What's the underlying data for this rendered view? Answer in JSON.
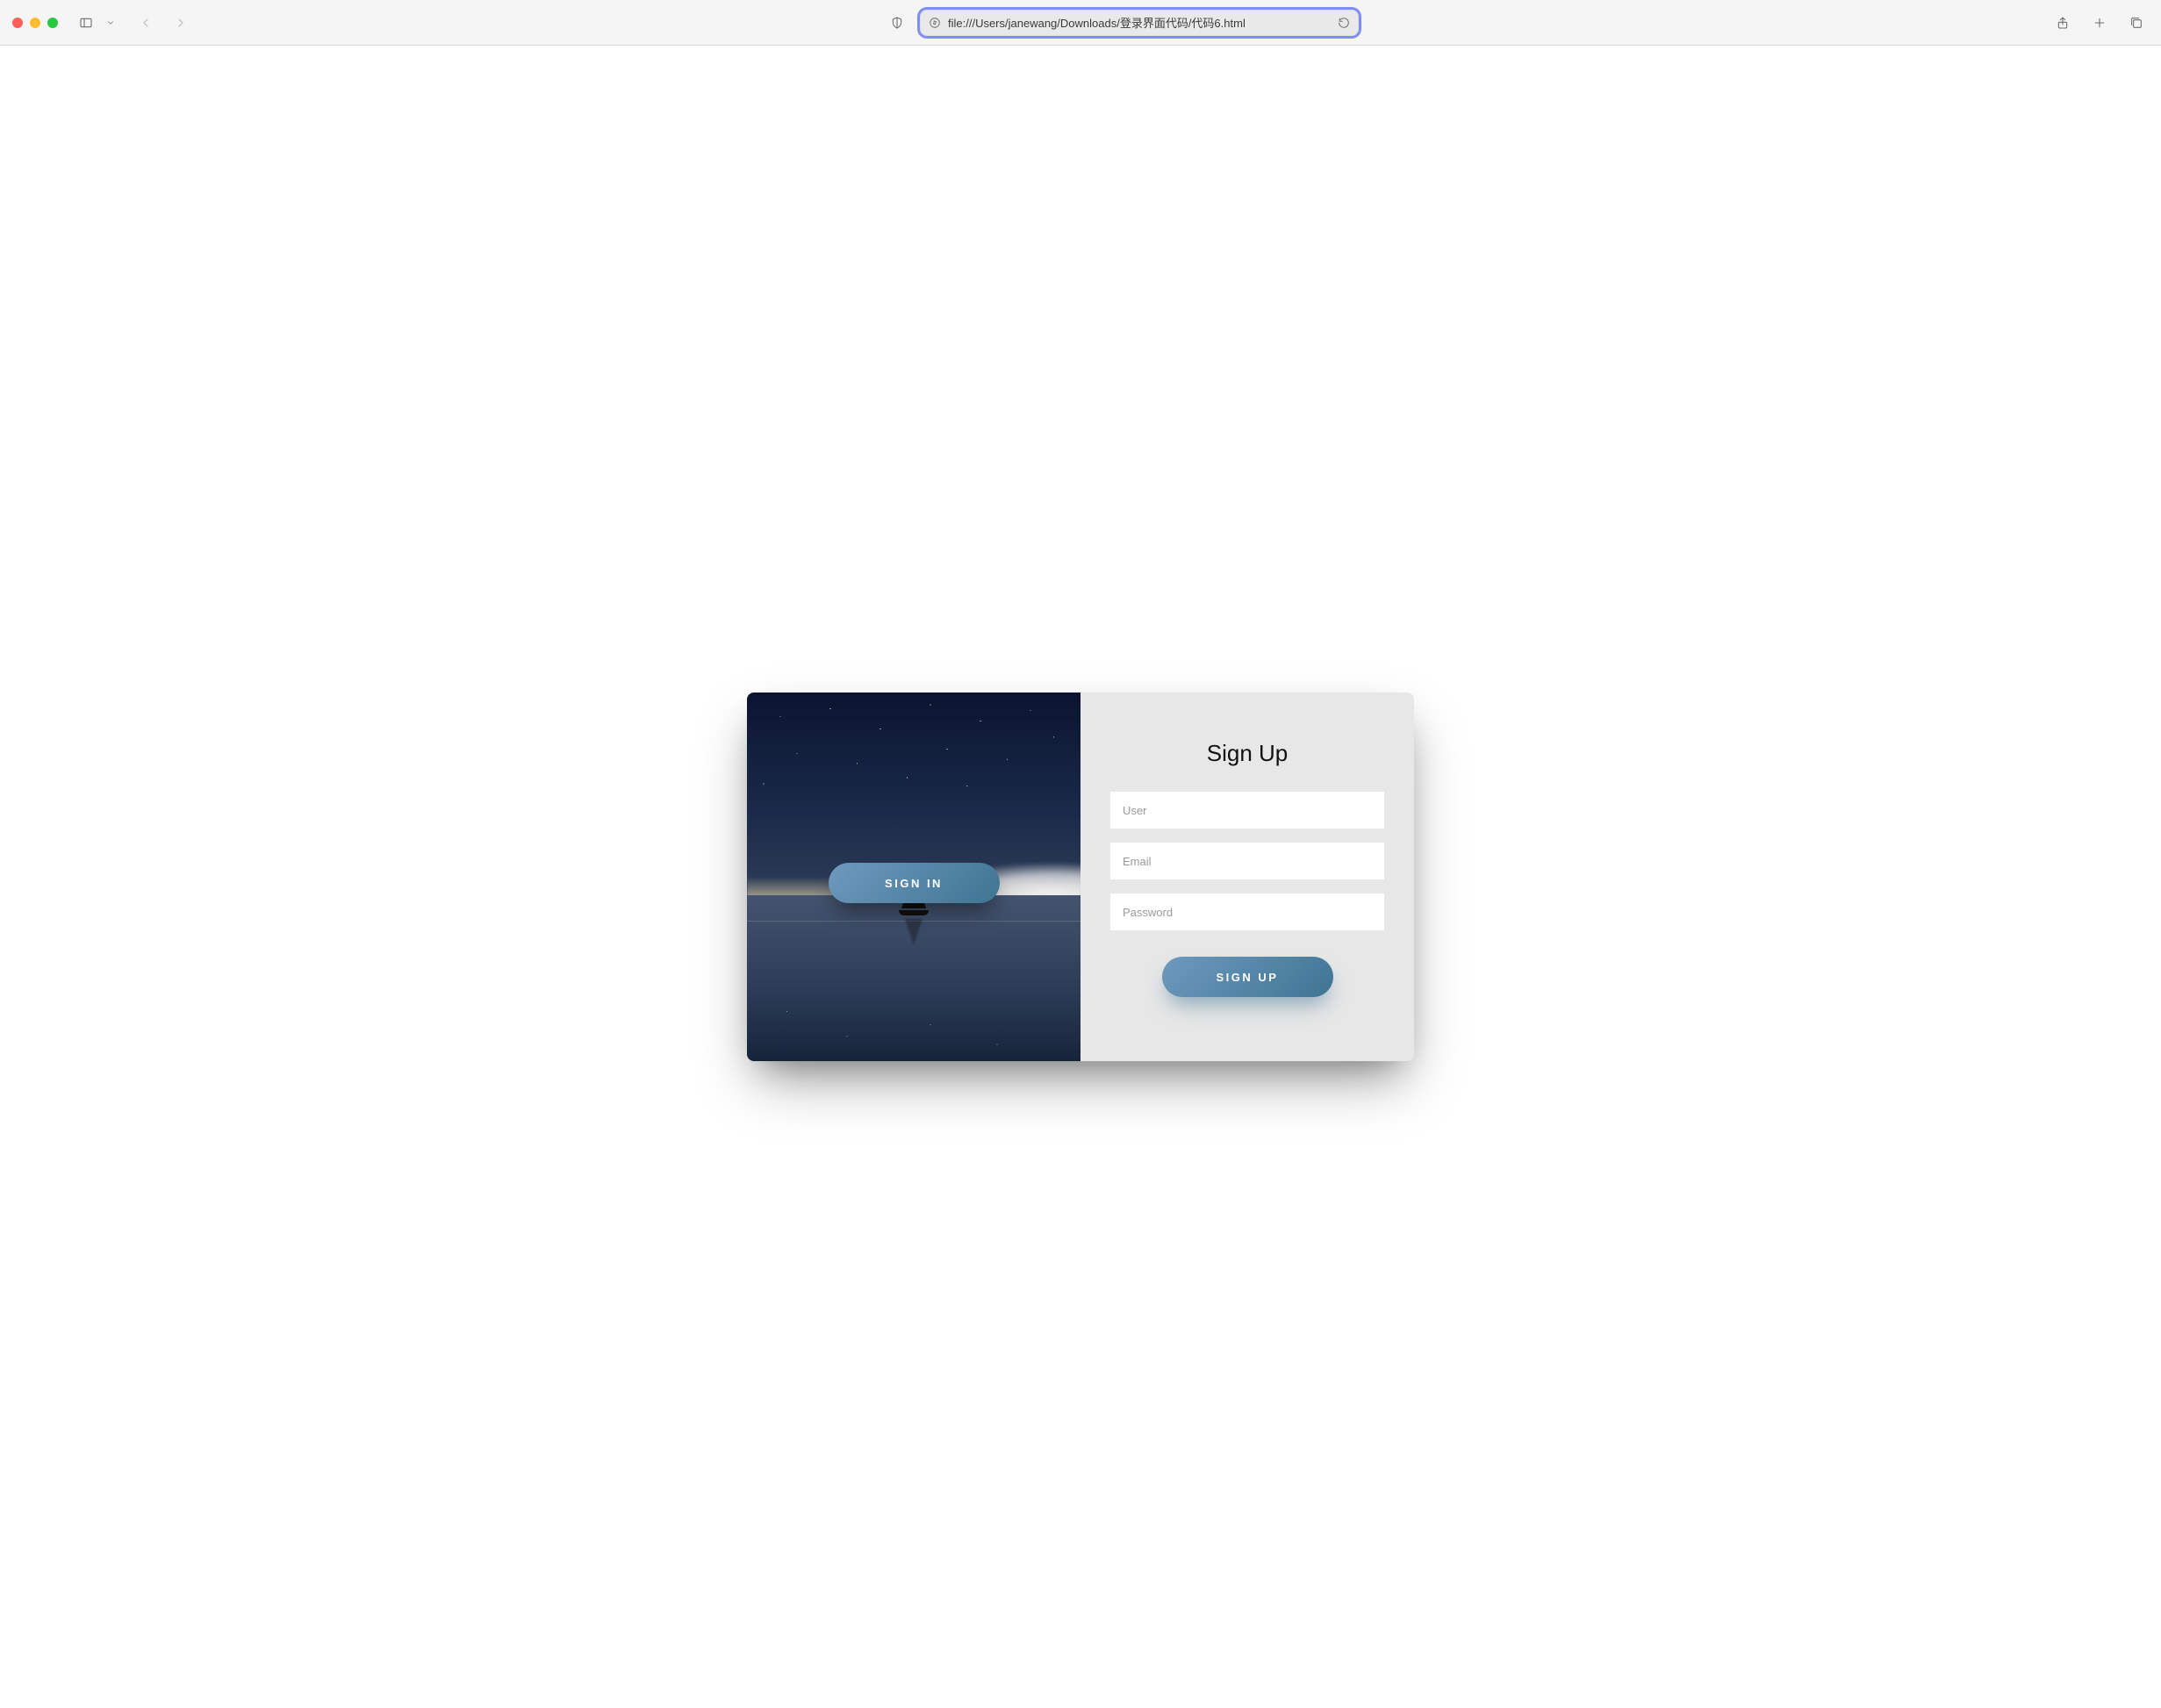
{
  "browser": {
    "url": "file:///Users/janewang/Downloads/登录界面代码/代码6.html",
    "icons": {
      "sidebar": "sidebar-icon",
      "sidebar_chevron": "chevron-down-icon",
      "back": "chevron-left-icon",
      "forward": "chevron-right-icon",
      "shield": "shield-icon",
      "compass": "compass-icon",
      "reload": "reload-icon",
      "share": "share-icon",
      "new_tab": "plus-icon",
      "tabs": "tabs-icon"
    }
  },
  "page": {
    "left": {
      "signin_label": "SIGN IN"
    },
    "right": {
      "title": "Sign Up",
      "user_placeholder": "User",
      "email_placeholder": "Email",
      "password_placeholder": "Password",
      "signup_label": "SIGN UP"
    }
  }
}
